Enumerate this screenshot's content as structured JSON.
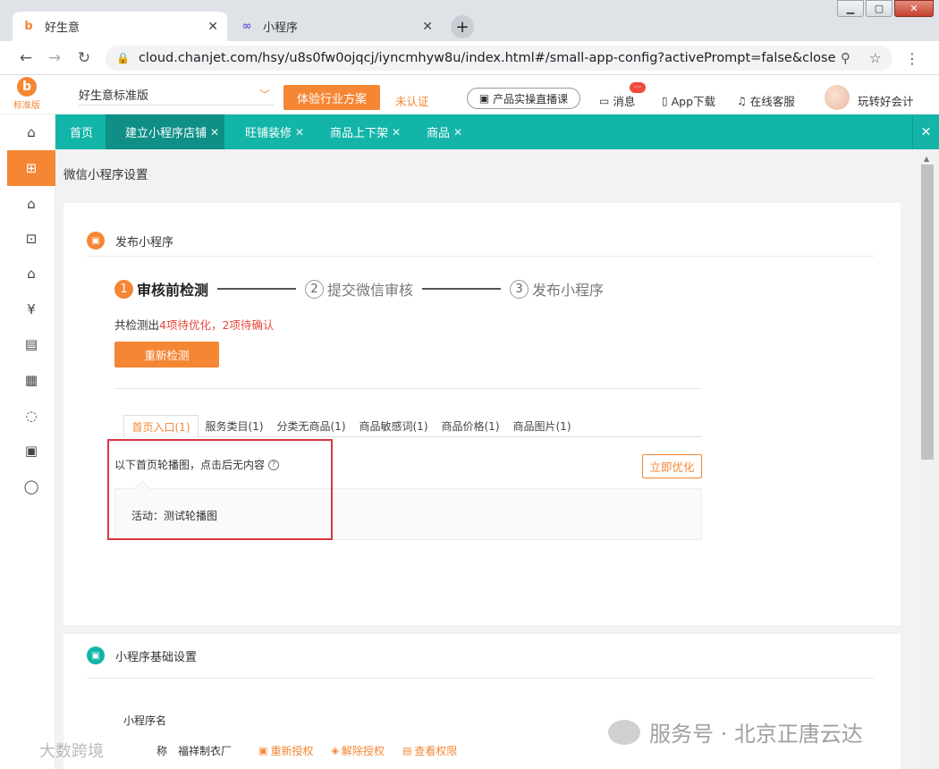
{
  "browser": {
    "tabs": [
      {
        "label": "好生意",
        "icon": "haoshengyi-favicon",
        "active": true
      },
      {
        "label": "小程序",
        "icon": "link-favicon",
        "active": false
      }
    ],
    "new_tab_label": "+",
    "url": "cloud.chanjet.com/hsy/u8s0fw0ojqcj/iyncmhyw8u/index.html#/small-app-config?activePrompt=false&closeProm..."
  },
  "app_header": {
    "brand_edition": "标准版",
    "edition_select": "好生意标准版",
    "try_button": "体验行业方案",
    "unverified": "未认证",
    "live_course": "产品实操直播课",
    "messages": "消息",
    "message_badge": "···",
    "app_download": "App下载",
    "online_service": "在线客服",
    "username": "玩转好会计"
  },
  "sidebar": {
    "icons": [
      "home-icon",
      "gift-icon",
      "home-settings-icon",
      "bag-icon",
      "warehouse-icon",
      "money-bag-icon",
      "clipboard-icon",
      "id-card-icon",
      "cycle-icon",
      "new-icon",
      "chat-icon"
    ],
    "active_index": 1
  },
  "nav_tabs": [
    {
      "label": "首页",
      "closable": false
    },
    {
      "label": "建立小程序店铺",
      "closable": true,
      "active": true
    },
    {
      "label": "旺铺装修",
      "closable": true
    },
    {
      "label": "商品上下架",
      "closable": true
    },
    {
      "label": "商品",
      "closable": true
    }
  ],
  "page": {
    "title": "微信小程序设置",
    "publish_section": {
      "title": "发布小程序",
      "steps": [
        {
          "num": "1",
          "label": "审核前检测",
          "active": true
        },
        {
          "num": "2",
          "label": "提交微信审核",
          "active": false
        },
        {
          "num": "3",
          "label": "发布小程序",
          "active": false
        }
      ],
      "summary_prefix": "共检测出",
      "summary_highlight": "4项待优化，2项待确认",
      "recheck_button": "重新检测",
      "issue_tabs": [
        "首页入口(1)",
        "服务类目(1)",
        "分类无商品(1)",
        "商品敏感词(1)",
        "商品价格(1)",
        "商品图片(1)"
      ],
      "issue_text": "以下首页轮播图，点击后无内容",
      "optimize_button": "立即优化",
      "detail": "活动：测试轮播图"
    },
    "basic_section": {
      "title": "小程序基础设置",
      "field_name_label": "小程序名",
      "field2_label": "称",
      "field2_value": "福祥制衣厂",
      "links": [
        "重新授权",
        "解除授权",
        "查看权限"
      ]
    }
  },
  "watermarks": {
    "right": "服务号 · 北京正唐云达",
    "left": "大数跨境"
  },
  "colors": {
    "accent": "#f58634",
    "nav_teal": "#13b5a8",
    "nav_active": "#0f8f86",
    "highlight_red": "#e9493a",
    "frame_red": "#d9363e"
  }
}
